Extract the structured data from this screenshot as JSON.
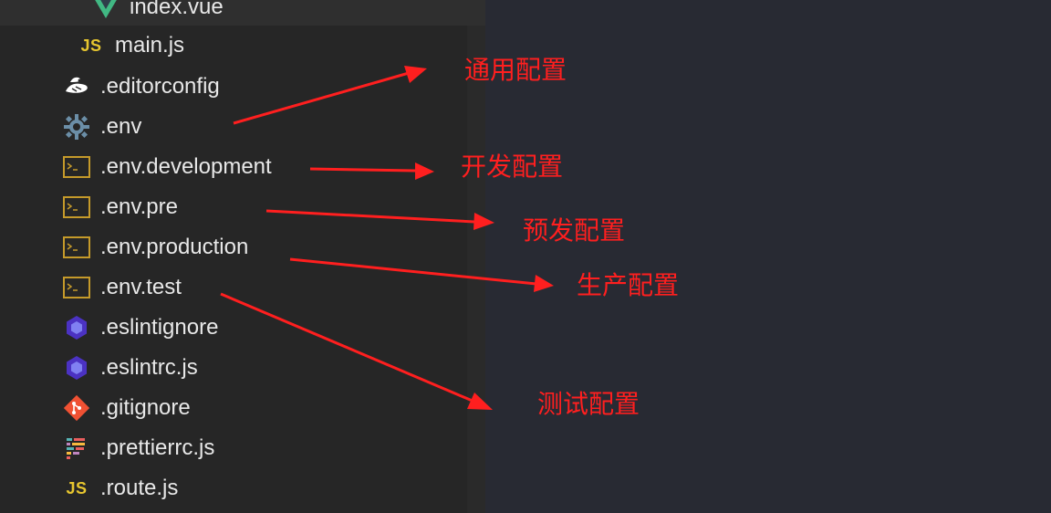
{
  "explorer": {
    "files": [
      {
        "label": "index.vue",
        "icon": "vue-icon"
      },
      {
        "label": "main.js",
        "icon": "js-icon",
        "icon_text": "JS"
      },
      {
        "label": ".editorconfig",
        "icon": "editorconfig-icon"
      },
      {
        "label": ".env",
        "icon": "gear-icon"
      },
      {
        "label": ".env.development",
        "icon": "terminal-icon"
      },
      {
        "label": ".env.pre",
        "icon": "terminal-icon"
      },
      {
        "label": ".env.production",
        "icon": "terminal-icon"
      },
      {
        "label": ".env.test",
        "icon": "terminal-icon"
      },
      {
        "label": ".eslintignore",
        "icon": "eslint-icon"
      },
      {
        "label": ".eslintrc.js",
        "icon": "eslint-icon"
      },
      {
        "label": ".gitignore",
        "icon": "git-icon"
      },
      {
        "label": ".prettierrc.js",
        "icon": "prettier-icon"
      },
      {
        "label": ".route.js",
        "icon": "js-icon",
        "icon_text": "JS"
      }
    ]
  },
  "annotations": [
    {
      "label": "通用配置"
    },
    {
      "label": "开发配置"
    },
    {
      "label": "预发配置"
    },
    {
      "label": "生产配置"
    },
    {
      "label": "测试配置"
    }
  ],
  "colors": {
    "editor_background": "#282a33",
    "sidebar_background": "#262626",
    "file_text": "#e8e8e8",
    "annotation_red": "#ff1f1f",
    "js_yellow": "#e7c62f",
    "vue_green": "#41b883",
    "terminal_gold": "#c59a2a",
    "eslint_purple": "#4b32c3",
    "git_orange": "#f05133",
    "gear_blue": "#6b8ea7"
  }
}
